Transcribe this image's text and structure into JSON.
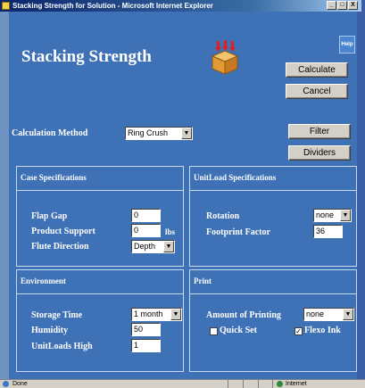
{
  "window": {
    "title": "Stacking Strength for Solution - Microsoft Internet Explorer",
    "controls": [
      "_",
      "□",
      "X"
    ]
  },
  "page": {
    "heading": "Stacking Strength",
    "help_label": "Help",
    "buttons": {
      "calculate": "Calculate",
      "cancel": "Cancel",
      "filter": "Filter",
      "dividers": "Dividers"
    },
    "calculation_method": {
      "label": "Calculation Method",
      "value": "Ring Crush"
    }
  },
  "case_specifications": {
    "title": "Case Specifications",
    "flap_gap": {
      "label": "Flap Gap",
      "value": "0"
    },
    "product_support": {
      "label": "Product Support",
      "value": "0",
      "unit": "lbs"
    },
    "flute_direction": {
      "label": "Flute Direction",
      "value": "Depth"
    }
  },
  "unitload_specifications": {
    "title": "UnitLoad Specifications",
    "rotation": {
      "label": "Rotation",
      "value": "none"
    },
    "footprint_factor": {
      "label": "Footprint Factor",
      "value": "36"
    }
  },
  "environment": {
    "title": "Environment",
    "storage_time": {
      "label": "Storage Time",
      "value": "1 month"
    },
    "humidity": {
      "label": "Humidity",
      "value": "50"
    },
    "unitloads_high": {
      "label": "UnitLoads High",
      "value": "1"
    }
  },
  "print": {
    "title": "Print",
    "amount_of_printing": {
      "label": "Amount of Printing",
      "value": "none"
    },
    "quick_set": {
      "label": "Quick Set",
      "checked": false
    },
    "flexo_ink": {
      "label": "Flexo Ink",
      "checked": true,
      "mark": "✓"
    }
  },
  "statusbar": {
    "status": "Done",
    "zone": "Internet"
  }
}
